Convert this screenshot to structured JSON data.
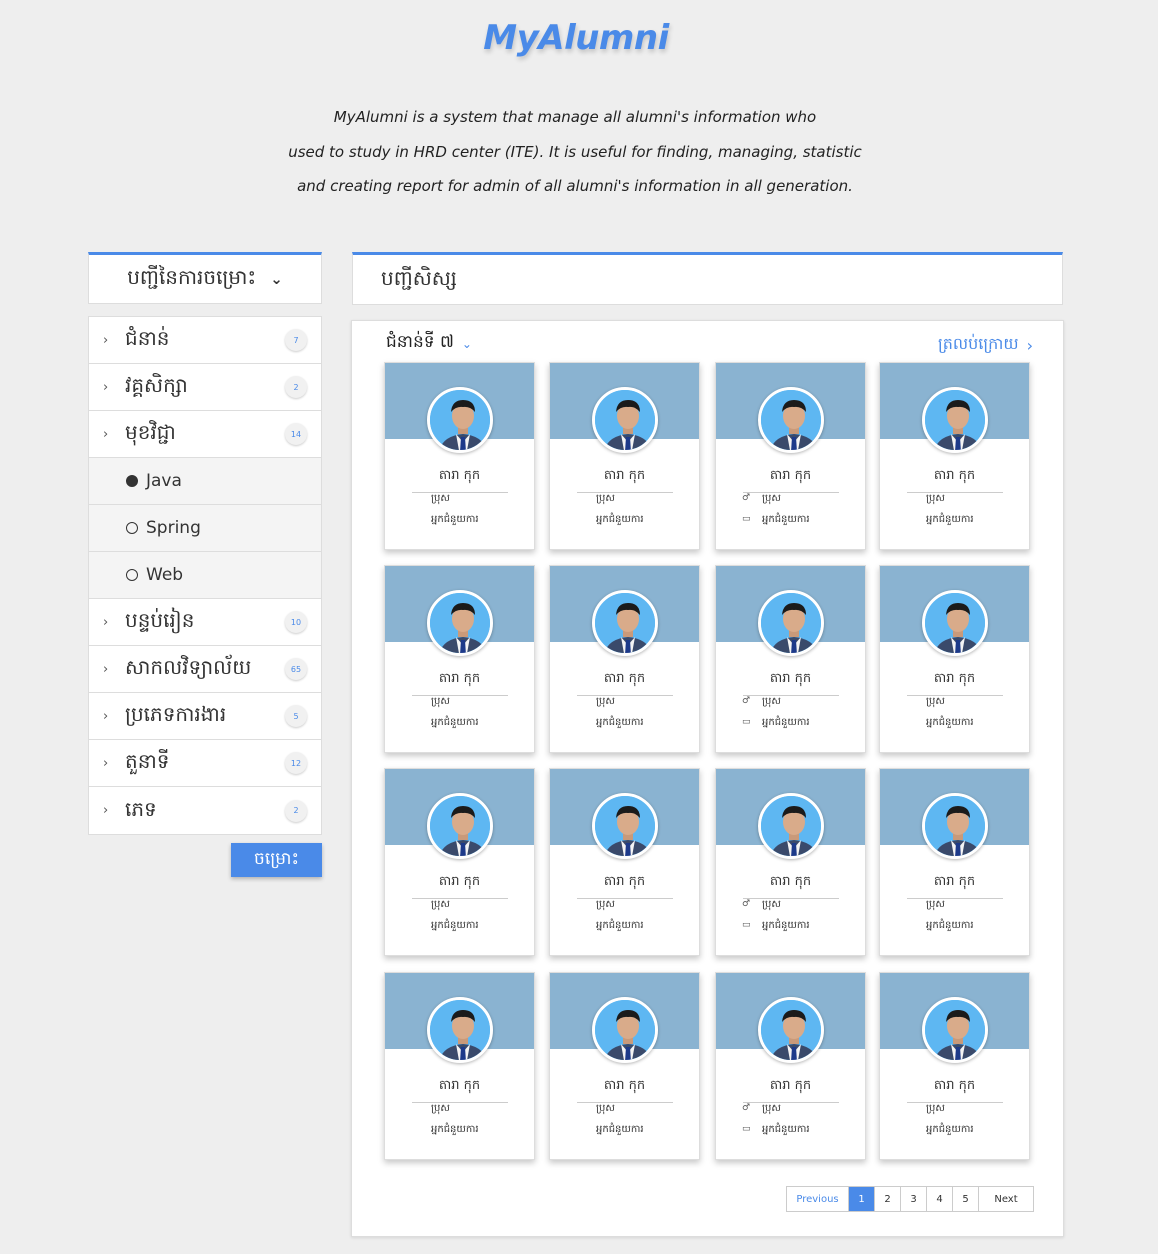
{
  "app": {
    "title": "MyAlumni",
    "description_lines": [
      "MyAlumni is a system that manage all alumni's information who",
      "used to study in HRD center (ITE). It is useful for finding, managing, statistic",
      "and creating report for admin of all alumni's information in all generation."
    ]
  },
  "sidebar": {
    "header": "បញ្ជីនៃការចម្រោះ",
    "items": [
      {
        "label": "ជំនាន់",
        "count": "7"
      },
      {
        "label": "វគ្គសិក្សា",
        "count": "2"
      },
      {
        "label": "មុខវិជ្ជា",
        "count": "14"
      },
      {
        "label": "បន្ទប់រៀន",
        "count": "10"
      },
      {
        "label": "សាកលវិទ្យាល័យ",
        "count": "65"
      },
      {
        "label": "ប្រភេទការងារ",
        "count": "5"
      },
      {
        "label": "តួនាទី",
        "count": "12"
      },
      {
        "label": "ភេទ",
        "count": "2"
      }
    ],
    "subitems": [
      {
        "label": "Java",
        "selected": true
      },
      {
        "label": "Spring",
        "selected": false
      },
      {
        "label": "Web",
        "selected": false
      }
    ],
    "filter_button": "ចម្រោះ"
  },
  "main": {
    "header": "បញ្ជីសិស្ស",
    "generation_select": "ជំនាន់ទី ៧",
    "back_link": "ត្រលប់ក្រោយ",
    "card_name": "តារា កុក",
    "card_gender": "ប្រុស",
    "card_role": "អ្នកជំនួយការ",
    "pagination": {
      "previous": "Previous",
      "pages": [
        "1",
        "2",
        "3",
        "4",
        "5"
      ],
      "current": "1",
      "next": "Next"
    }
  },
  "colors": {
    "accent": "#4a8ae8",
    "card_banner": "#8ab3d1"
  }
}
